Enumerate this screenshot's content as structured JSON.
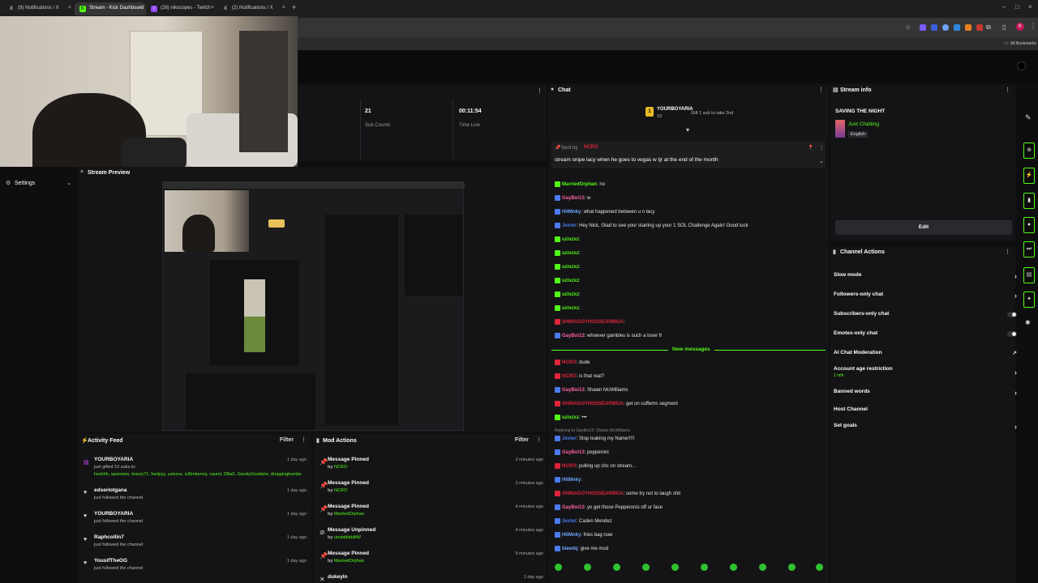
{
  "browser": {
    "tabs": [
      {
        "label": "(9) Notifications / X",
        "icon": "x-logo-icon"
      },
      {
        "label": "Stream - Kick Dashboard",
        "icon": "kick-logo-icon"
      },
      {
        "label": "(28) nikocopes - Twitch",
        "icon": "twitch-logo-icon"
      },
      {
        "label": "(2) Notifications / X",
        "icon": "x-logo-icon"
      }
    ],
    "new_tab": "+",
    "bookmarks_label": "All Bookmarks"
  },
  "stats": {
    "subs_value": "21",
    "subs_label": "Sub Counts",
    "time_value": "00:11:54",
    "time_label": "Time Live"
  },
  "sidebar": {
    "items": [
      {
        "label": "Settings"
      }
    ]
  },
  "stream_preview": {
    "title": "Stream Preview"
  },
  "activity_feed": {
    "title": "Activity Feed",
    "filter_label": "Filter",
    "items": [
      {
        "name": "YOURBOYARIA",
        "sub": "just gifted 10 subs to:",
        "names": "hsshhh, sparrows, itsizzy71, fredyyy, uzixzxz, icl0mbenny, cauml, D8aX, GoodyGoodwin, droppingbombs",
        "time": "1 day ago"
      },
      {
        "name": "edseriotgana",
        "sub": "just followed the channel",
        "time": "1 day ago"
      },
      {
        "name": "YOURBOYARIA",
        "sub": "just followed the channel",
        "time": "1 day ago"
      },
      {
        "name": "Raphcollin7",
        "sub": "just followed the channel",
        "time": "1 day ago"
      },
      {
        "name": "YousifTheOG",
        "sub": "just followed the channel",
        "time": "1 day ago"
      }
    ]
  },
  "mod_actions": {
    "title": "Mod Actions",
    "filter_label": "Filter",
    "items": [
      {
        "name": "Message Pinned",
        "by": "by",
        "user": "NCRO",
        "time": "3 minutes ago"
      },
      {
        "name": "Message Pinned",
        "by": "by",
        "user": "NCRO",
        "time": "3 minutes ago"
      },
      {
        "name": "Message Pinned",
        "by": "by",
        "user": "MarriedOrphan",
        "time": "4 minutes ago"
      },
      {
        "name": "Message Unpinned",
        "by": "by",
        "user": "unstableblitW",
        "time": "4 minutes ago"
      },
      {
        "name": "Message Pinned",
        "by": "by",
        "user": "MarriedOrphan",
        "time": "9 minutes ago"
      },
      {
        "name": "dukeyln",
        "by": "",
        "user": "",
        "time": "1 day ago"
      }
    ]
  },
  "chat": {
    "title": "Chat",
    "gift_user": "YOURBOYARIA",
    "gift_count": "10",
    "gift_text": "Gift 1 sub to take 2nd",
    "pinned_label": "Sent by",
    "pinned_user": "NCRO",
    "pinned_text": "stream snipe lacy when he goes to vegas w tjr at the end of the month",
    "new_messages_label": "New messages",
    "reply_text": "Replying to GayBoi13: Shawn McWilliams",
    "messages": [
      {
        "user": "MarriedOrphan",
        "color": "u-green",
        "text": "no"
      },
      {
        "user": "GayBoi13",
        "color": "u-pink",
        "text": "w"
      },
      {
        "user": "HitMnky",
        "color": "u-lblue",
        "text": "what happened between u n lacy"
      },
      {
        "user": "Jexter",
        "color": "u-blue",
        "text": "Hey Nick, Glad to see your starting up your 1 SOL Challenge Again! Good luck"
      },
      {
        "user": "uzixzxz",
        "color": "u-green",
        "text": ""
      },
      {
        "user": "uzixzxz",
        "color": "u-green",
        "text": ""
      },
      {
        "user": "uzixzxz",
        "color": "u-green",
        "text": ""
      },
      {
        "user": "uzixzxz",
        "color": "u-green",
        "text": ""
      },
      {
        "user": "uzixzxz",
        "color": "u-green",
        "text": ""
      },
      {
        "user": "uzixzxz",
        "color": "u-green",
        "text": ""
      },
      {
        "user": "SHINAGOYHOSSEARMOA",
        "color": "u-red",
        "text": ""
      },
      {
        "user": "GayBoi13",
        "color": "u-pink",
        "text": "whoever gambles is such a loser fr"
      }
    ],
    "messages2": [
      {
        "user": "NCRO",
        "color": "u-red",
        "text": "dude"
      },
      {
        "user": "NCRO",
        "color": "u-red",
        "text": "is that real?"
      },
      {
        "user": "GayBoi13",
        "color": "u-pink",
        "text": "Shawn McWilliams"
      },
      {
        "user": "SHINAGOYHOSSEARMOA",
        "color": "u-red",
        "text": "get on cuffems segment"
      },
      {
        "user": "uzixzxz",
        "color": "u-green",
        "text": "•••"
      },
      {
        "user": "Jexter",
        "color": "u-blue",
        "text": "Stop leaking my Name!!!!!"
      },
      {
        "user": "GayBoi13",
        "color": "u-pink",
        "text": "pepperoni"
      },
      {
        "user": "NCRO",
        "color": "u-red",
        "text": "pulling up chc on stream..."
      },
      {
        "user": "HitMnky",
        "color": "u-lblue",
        "text": ""
      },
      {
        "user": "SHINAGOYHOSSEARMOA",
        "color": "u-red",
        "text": "some try not to laugh shit"
      },
      {
        "user": "GayBoi13",
        "color": "u-pink",
        "text": "yo get those Pepperonis off ur face"
      },
      {
        "user": "Jexter",
        "color": "u-blue",
        "text": "Caden Mendez"
      },
      {
        "user": "HitMnky",
        "color": "u-lblue",
        "text": "fries bag now"
      },
      {
        "user": "bleedq",
        "color": "u-lblue",
        "text": "give me mod"
      }
    ]
  },
  "stream_info": {
    "title": "Stream info",
    "stream_title": "SAVING THE NIGHT",
    "category": "Just Chatting",
    "language": "English",
    "edit_label": "Edit"
  },
  "channel_actions": {
    "title": "Channel Actions",
    "items": [
      {
        "label": "Slow mode",
        "control": "chevron"
      },
      {
        "label": "Followers-only chat",
        "control": "chevron"
      },
      {
        "label": "Subscribers-only chat",
        "control": "toggle"
      },
      {
        "label": "Emotes-only chat",
        "control": "toggle"
      },
      {
        "label": "AI Chat Moderation",
        "control": "external"
      },
      {
        "label": "Account age restriction",
        "sub": "1 mth",
        "control": "chevron"
      },
      {
        "label": "Banned words",
        "control": "chevron"
      },
      {
        "label": "Host Channel",
        "control": "none"
      },
      {
        "label": "Set goals",
        "control": "chevron"
      }
    ]
  },
  "colors": {
    "accent": "#53fc18",
    "bg": "#0e0e10",
    "panel": "#141416"
  }
}
